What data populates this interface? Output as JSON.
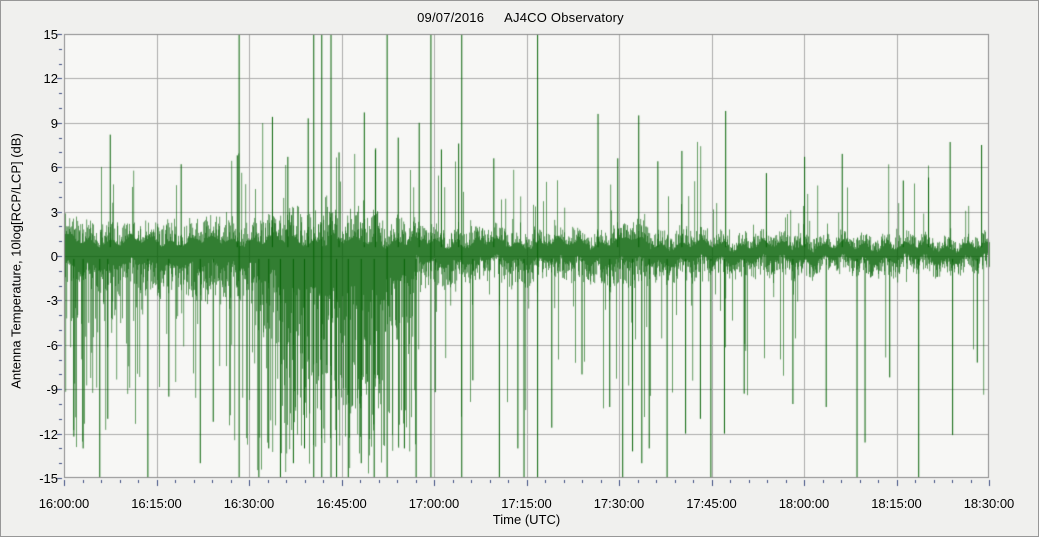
{
  "header": {
    "date": "09/07/2016",
    "observatory": "AJ4CO Observatory"
  },
  "chart_data": {
    "type": "line",
    "title": "09/07/2016  AJ4CO Observatory",
    "xlabel": "Time (UTC)",
    "ylabel": "Antenna Temperature, 10log[RCP/LCP] (dB)",
    "note": "Dense dark-green radio strip-chart noise trace centered near +0.4 dB; heavy negative excursions 16:31-16:57, calming toward 18:30; scattered spikes clip at +/-15 dB.",
    "xticks": [
      "16:00:00",
      "16:15:00",
      "16:30:00",
      "16:45:00",
      "17:00:00",
      "17:15:00",
      "17:30:00",
      "17:45:00",
      "18:00:00",
      "18:15:00",
      "18:30:00"
    ],
    "x_start": "16:00:00",
    "x_end": "18:30:00",
    "duration_min": 150,
    "x_major_tick_min": 15,
    "x_minor_tick_min": 3,
    "yticks": [
      15,
      12,
      9,
      6,
      3,
      0,
      -3,
      -6,
      -9,
      -12,
      -15
    ],
    "ylim": [
      -15,
      15
    ],
    "y_major_tick": 3,
    "y_minor_tick": 1,
    "grid": true,
    "line_color": "#086408",
    "plot_bg": "#f7f7f5",
    "grid_color": "#ababab",
    "axis_color": "#8a8a8a",
    "tick_color": "#3c4c80",
    "envelope_segments": [
      {
        "t0": 0,
        "t1": 2,
        "base": 0.4,
        "hi": 2.6,
        "lo": -3.2,
        "hi_ext": 6,
        "lo_ext": -13,
        "p_hi": 0.04,
        "p_lo": 0.3
      },
      {
        "t0": 2,
        "t1": 8,
        "base": 0.4,
        "hi": 2.3,
        "lo": -2.8,
        "hi_ext": 8,
        "lo_ext": -14,
        "p_hi": 0.05,
        "p_lo": 0.22
      },
      {
        "t0": 8,
        "t1": 20,
        "base": 0.4,
        "hi": 2.2,
        "lo": -2.4,
        "hi_ext": 6,
        "lo_ext": -12,
        "p_hi": 0.05,
        "p_lo": 0.14
      },
      {
        "t0": 20,
        "t1": 26,
        "base": 0.4,
        "hi": 2.3,
        "lo": -3.0,
        "hi_ext": 6,
        "lo_ext": -13,
        "p_hi": 0.04,
        "p_lo": 0.22
      },
      {
        "t0": 26,
        "t1": 31,
        "base": 0.4,
        "hi": 2.4,
        "lo": -2.4,
        "hi_ext": 7,
        "lo_ext": -15,
        "p_hi": 0.06,
        "p_lo": 0.14
      },
      {
        "t0": 31,
        "t1": 35,
        "base": 0.3,
        "hi": 2.6,
        "lo": -5.0,
        "hi_ext": 9,
        "lo_ext": -15,
        "p_hi": 0.07,
        "p_lo": 0.35
      },
      {
        "t0": 35,
        "t1": 43,
        "base": 0.2,
        "hi": 2.8,
        "lo": -7.0,
        "hi_ext": 8,
        "lo_ext": -15,
        "p_hi": 0.09,
        "p_lo": 0.5
      },
      {
        "t0": 43,
        "t1": 52,
        "base": 0.1,
        "hi": 2.8,
        "lo": -8.0,
        "hi_ext": 9,
        "lo_ext": -15,
        "p_hi": 0.09,
        "p_lo": 0.55
      },
      {
        "t0": 52,
        "t1": 57,
        "base": 0.3,
        "hi": 2.3,
        "lo": -4.5,
        "hi_ext": 7,
        "lo_ext": -14,
        "p_hi": 0.07,
        "p_lo": 0.35
      },
      {
        "t0": 57,
        "t1": 62,
        "base": 0.4,
        "hi": 1.9,
        "lo": -2.0,
        "hi_ext": 6,
        "lo_ext": -10,
        "p_hi": 0.05,
        "p_lo": 0.12
      },
      {
        "t0": 62,
        "t1": 75,
        "base": 0.4,
        "hi": 1.8,
        "lo": -1.7,
        "hi_ext": 7,
        "lo_ext": -12,
        "p_hi": 0.05,
        "p_lo": 0.07
      },
      {
        "t0": 75,
        "t1": 87,
        "base": 0.4,
        "hi": 1.7,
        "lo": -1.6,
        "hi_ext": 6,
        "lo_ext": -10,
        "p_hi": 0.05,
        "p_lo": 0.06
      },
      {
        "t0": 87,
        "t1": 95,
        "base": 0.4,
        "hi": 2.1,
        "lo": -2.0,
        "hi_ext": 8,
        "lo_ext": -14,
        "p_hi": 0.07,
        "p_lo": 0.12
      },
      {
        "t0": 95,
        "t1": 105,
        "base": 0.3,
        "hi": 1.7,
        "lo": -1.6,
        "hi_ext": 8,
        "lo_ext": -12,
        "p_hi": 0.05,
        "p_lo": 0.08
      },
      {
        "t0": 105,
        "t1": 120,
        "base": 0.3,
        "hi": 1.5,
        "lo": -1.4,
        "hi_ext": 6,
        "lo_ext": -10,
        "p_hi": 0.04,
        "p_lo": 0.06
      },
      {
        "t0": 120,
        "t1": 135,
        "base": 0.25,
        "hi": 1.4,
        "lo": -1.2,
        "hi_ext": 7,
        "lo_ext": -12,
        "p_hi": 0.04,
        "p_lo": 0.04
      },
      {
        "t0": 135,
        "t1": 150,
        "base": 0.25,
        "hi": 1.3,
        "lo": -1.1,
        "hi_ext": 7,
        "lo_ext": -12,
        "p_hi": 0.04,
        "p_lo": 0.04
      }
    ],
    "full_range_spikes_min": [
      28.4,
      40.5,
      41.8,
      43.3,
      52.4,
      59.5,
      64.5,
      76.8
    ],
    "spikes": [
      [
        7.5,
        8.2
      ],
      [
        19.0,
        6.2
      ],
      [
        28.1,
        6.8
      ],
      [
        33.8,
        9.4
      ],
      [
        36.3,
        6.7
      ],
      [
        39.6,
        9.3
      ],
      [
        44.6,
        7.0
      ],
      [
        48.7,
        9.7
      ],
      [
        50.5,
        7.2
      ],
      [
        54.2,
        8.0
      ],
      [
        57.6,
        9.0
      ],
      [
        61.2,
        7.2
      ],
      [
        64.0,
        7.6
      ],
      [
        69.7,
        6.6
      ],
      [
        86.6,
        9.6
      ],
      [
        89.8,
        6.6
      ],
      [
        93.2,
        9.5
      ],
      [
        96.3,
        6.4
      ],
      [
        100.2,
        7.1
      ],
      [
        107.3,
        9.8
      ],
      [
        113.9,
        5.6
      ],
      [
        120.1,
        6.7
      ],
      [
        126.2,
        6.9
      ],
      [
        136.1,
        5.1
      ],
      [
        140.2,
        5.3
      ],
      [
        143.7,
        7.7
      ],
      [
        148.8,
        7.5
      ],
      [
        1.6,
        -12.2
      ],
      [
        3.1,
        -13
      ],
      [
        5.8,
        -15
      ],
      [
        7.1,
        -11
      ],
      [
        13.6,
        -15
      ],
      [
        17.0,
        -9.5
      ],
      [
        22.1,
        -14
      ],
      [
        24.2,
        -11.2
      ],
      [
        31.6,
        -15
      ],
      [
        33.2,
        -13
      ],
      [
        35.1,
        -15
      ],
      [
        37.2,
        -14
      ],
      [
        39.0,
        -13
      ],
      [
        44.2,
        -15
      ],
      [
        46.1,
        -15
      ],
      [
        48.2,
        -14
      ],
      [
        50.3,
        -15
      ],
      [
        55.2,
        -13
      ],
      [
        57.1,
        -15
      ],
      [
        60.2,
        -9.2
      ],
      [
        66.3,
        -8.4
      ],
      [
        70.6,
        -15
      ],
      [
        73.6,
        -13
      ],
      [
        74.6,
        -15
      ],
      [
        79.1,
        -11.6
      ],
      [
        84.0,
        -8.0
      ],
      [
        88.5,
        -10.2
      ],
      [
        90.6,
        -15
      ],
      [
        92.2,
        -13.2
      ],
      [
        93.7,
        -14
      ],
      [
        94.9,
        -13
      ],
      [
        97.8,
        -15
      ],
      [
        100.8,
        -12
      ],
      [
        103.2,
        -11
      ],
      [
        104.9,
        -15
      ],
      [
        107.1,
        -12
      ],
      [
        110.3,
        -9.3
      ],
      [
        118.2,
        -10
      ],
      [
        123.6,
        -10.2
      ],
      [
        128.6,
        -15
      ],
      [
        129.9,
        -12.6
      ],
      [
        133.9,
        -8.2
      ],
      [
        138.6,
        -15
      ],
      [
        144.1,
        -12.1
      ],
      [
        148.1,
        -7.2
      ]
    ]
  }
}
